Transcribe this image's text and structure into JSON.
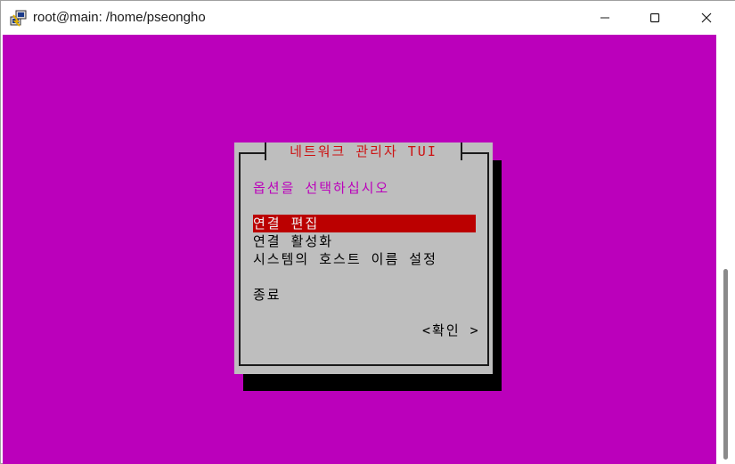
{
  "window": {
    "title": "root@main: /home/pseongho",
    "icons": {
      "app": "putty-icon",
      "minimize": "minimize-icon",
      "maximize": "maximize-icon",
      "close": "close-icon"
    }
  },
  "colors": {
    "terminal_background": "#bb00bb",
    "dialog_background": "#bebebe",
    "dialog_title": "#cc1111",
    "prompt_text": "#bb00bb",
    "selected_item": "#bb0000"
  },
  "dialog": {
    "title": "네트워크 관리자 TUI",
    "prompt": "옵션을 선택하십시오",
    "menu": [
      {
        "label": "연결 편집",
        "selected": true
      },
      {
        "label": "연결 활성화",
        "selected": false
      },
      {
        "label": "시스템의 호스트 이름 설정",
        "selected": false
      },
      {
        "label": "종료",
        "selected": false
      }
    ],
    "ok_button": "<확인 >"
  }
}
